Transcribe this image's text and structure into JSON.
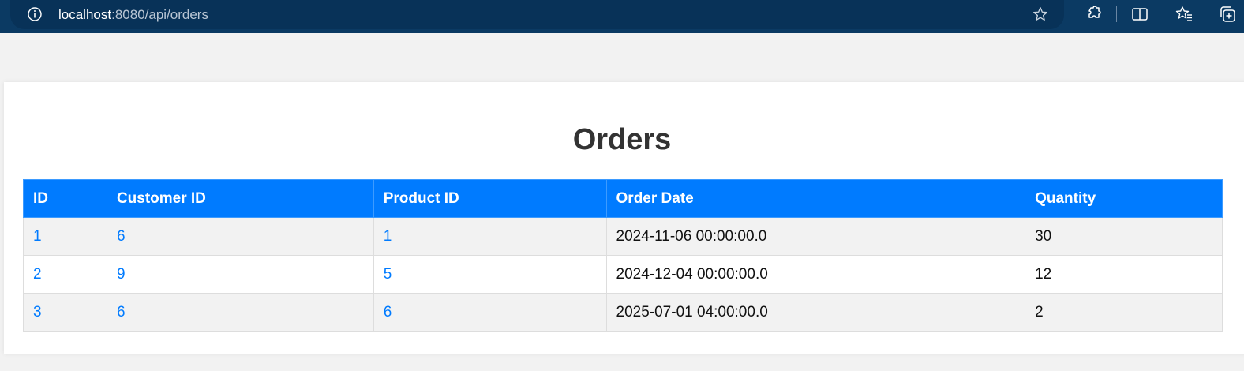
{
  "browser": {
    "url_host": "localhost",
    "url_rest": ":8080/api/orders"
  },
  "page": {
    "title": "Orders"
  },
  "table": {
    "headers": [
      "ID",
      "Customer ID",
      "Product ID",
      "Order Date",
      "Quantity"
    ],
    "rows": [
      [
        "1",
        "6",
        "1",
        "2024-11-06 00:00:00.0",
        "30"
      ],
      [
        "2",
        "9",
        "5",
        "2024-12-04 00:00:00.0",
        "12"
      ],
      [
        "3",
        "6",
        "6",
        "2025-07-01 04:00:00.0",
        "2"
      ]
    ]
  },
  "colors": {
    "header_bg": "#007bff",
    "link": "#007bff",
    "browser_bar": "#0b3a63"
  }
}
